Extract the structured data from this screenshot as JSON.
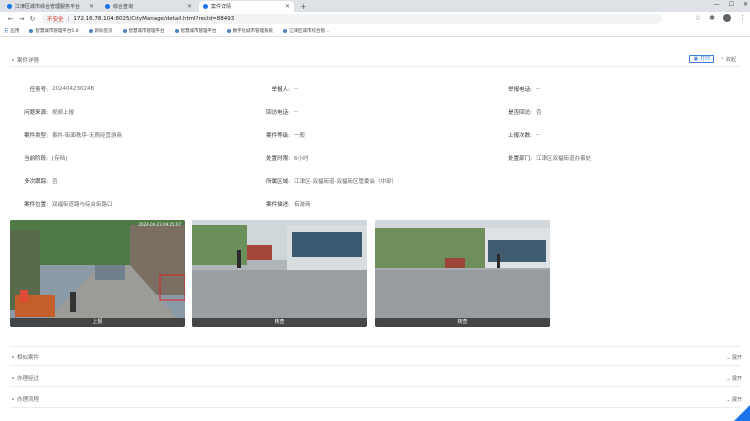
{
  "browser": {
    "tabs": [
      {
        "title": "江津区城市综合管理服务平台",
        "active": false
      },
      {
        "title": "综合查询",
        "active": false
      },
      {
        "title": "案件详情",
        "active": true
      }
    ],
    "new_tab": "+",
    "url_warning": "不安全",
    "url": "172.16.78.104:8025/CityManage/detail.html?recId=88493",
    "bookmarks": [
      "应用",
      "智慧城市管理平台5.6",
      "新标签页",
      "智慧城市管理平台",
      "智慧城市管理平台",
      "数字化城市管理系统",
      "江津区城市综合管..."
    ]
  },
  "page": {
    "section_title": "案件详情",
    "print_label": "打印",
    "collapse_label": "收起",
    "fields": {
      "task_no_label": "任务号:",
      "task_no": "202404230248",
      "reporter_label": "举报人:",
      "reporter": "--",
      "report_phone_label": "举报电话:",
      "report_phone": "--",
      "source_label": "问题来源:",
      "source": "视频上报",
      "callback_phone_label": "回访电话:",
      "callback_phone": "--",
      "is_callback_label": "是否回访:",
      "is_callback": "否",
      "case_type_label": "案件类型:",
      "case_type": "事件-街面秩序-无照经营游商",
      "case_level_label": "案件等级:",
      "case_level": "一般",
      "report_count_label": "上报次数:",
      "report_count": "--",
      "stage_label": "当前阶段:",
      "stage": "[存档]",
      "handle_time_label": "处置时限:",
      "handle_time": "6小时",
      "dept_label": "处置部门:",
      "dept": "江津区双福街道办事处",
      "multi_label": "多次跟踪:",
      "multi": "否",
      "area_label": "所属区域:",
      "area": "江津区-双福街道-双福街区管委会（中部）",
      "location_label": "案件位置:",
      "location": "双福街道路与综合街路口",
      "desc_label": "案件描述:",
      "desc": "有游商"
    },
    "photos": [
      {
        "caption": "上报",
        "timestamp": "2024-04-23 09:25:07"
      },
      {
        "caption": "核查",
        "timestamp": ""
      },
      {
        "caption": "核查",
        "timestamp": ""
      }
    ],
    "collapsed_sections": [
      {
        "title": "相似案件",
        "expand": "展开"
      },
      {
        "title": "办理经过",
        "expand": "展开"
      },
      {
        "title": "办理流程",
        "expand": "展开"
      }
    ]
  }
}
